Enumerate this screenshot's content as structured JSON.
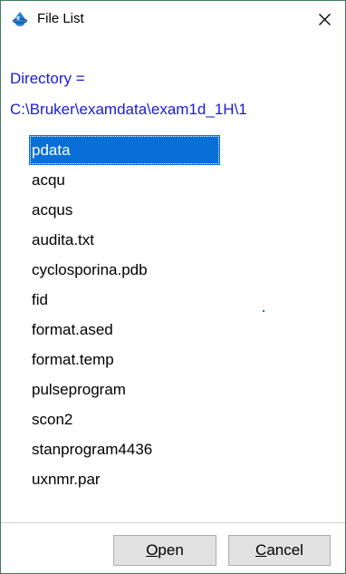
{
  "window": {
    "title": "File List",
    "icon": "bruker-app-icon",
    "close_icon": "close-icon"
  },
  "directory": {
    "label": "Directory =",
    "path": "C:\\Bruker\\examdata\\exam1d_1H\\1"
  },
  "files": [
    {
      "name": "pdata",
      "selected": true
    },
    {
      "name": "acqu",
      "selected": false
    },
    {
      "name": "acqus",
      "selected": false
    },
    {
      "name": "audita.txt",
      "selected": false
    },
    {
      "name": "cyclosporina.pdb",
      "selected": false
    },
    {
      "name": "fid",
      "selected": false
    },
    {
      "name": "format.ased",
      "selected": false
    },
    {
      "name": "format.temp",
      "selected": false
    },
    {
      "name": "pulseprogram",
      "selected": false
    },
    {
      "name": "scon2",
      "selected": false
    },
    {
      "name": "stanprogram4436",
      "selected": false
    },
    {
      "name": "uxnmr.par",
      "selected": false
    }
  ],
  "buttons": {
    "open": {
      "mnemonic": "O",
      "rest": "pen"
    },
    "cancel": {
      "mnemonic": "C",
      "rest": "ancel"
    }
  },
  "colors": {
    "directory_text": "#1a1adc",
    "selection": "#0a6ed8",
    "window_border": "#3f7a5a"
  }
}
